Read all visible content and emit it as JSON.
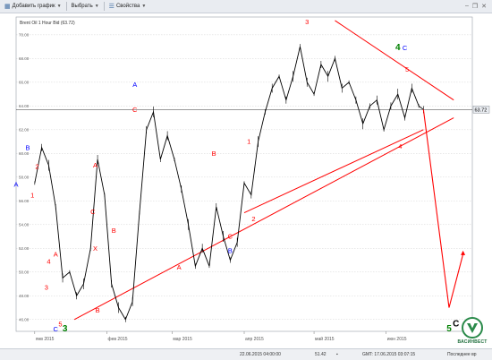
{
  "toolbar": {
    "items": [
      {
        "label": "Добавить график",
        "icon": "add-chart-icon"
      },
      {
        "label": "Выбрать",
        "icon": "select-icon"
      },
      {
        "label": "Свойства",
        "icon": "properties-icon"
      }
    ]
  },
  "chart_data": {
    "type": "line",
    "instrument_label": "Brent Oil 1 Hour Bid (63.72)",
    "last_price": "63.72",
    "colors": {
      "price": "#000000",
      "trendlines": "#ff0000",
      "labels_red": "#ff0000",
      "labels_blue": "#0000ff",
      "labels_green": "#008000",
      "grid": "#c8c8c8"
    },
    "grid": true,
    "y_ticks": [
      "70.00",
      "68.00",
      "66.00",
      "64.00",
      "62.00",
      "60.00",
      "58.00",
      "56.00",
      "54.00",
      "52.00",
      "50.00",
      "48.00",
      "46.00"
    ],
    "x_ticks": [
      "янв 2015",
      "фев 2015",
      "мар 2015",
      "апр 2015",
      "май 2015",
      "июн 2015"
    ],
    "series": [
      {
        "x": [
          "2015-01-01",
          "2015-01-04",
          "2015-01-07",
          "2015-01-10",
          "2015-01-13",
          "2015-01-16",
          "2015-01-19",
          "2015-01-22",
          "2015-01-25",
          "2015-01-28",
          "2015-01-31",
          "2015-02-03",
          "2015-02-06",
          "2015-02-09",
          "2015-02-12",
          "2015-02-15",
          "2015-02-18",
          "2015-02-21",
          "2015-02-24",
          "2015-02-27",
          "2015-03-02",
          "2015-03-05",
          "2015-03-08",
          "2015-03-11",
          "2015-03-14",
          "2015-03-17",
          "2015-03-20",
          "2015-03-23",
          "2015-03-26",
          "2015-03-29",
          "2015-04-01",
          "2015-04-04",
          "2015-04-07",
          "2015-04-10",
          "2015-04-13",
          "2015-04-16",
          "2015-04-19",
          "2015-04-22",
          "2015-04-25",
          "2015-04-28",
          "2015-05-01",
          "2015-05-04",
          "2015-05-07",
          "2015-05-10",
          "2015-05-13",
          "2015-05-16",
          "2015-05-19",
          "2015-05-22",
          "2015-05-25",
          "2015-05-28",
          "2015-05-31",
          "2015-06-03",
          "2015-06-06",
          "2015-06-09",
          "2015-06-12",
          "2015-06-15",
          "2015-06-17"
        ],
        "values": [
          57.5,
          60.5,
          59.0,
          55.5,
          49.5,
          50.0,
          48.0,
          49.0,
          52.0,
          59.5,
          56.5,
          49.0,
          47.0,
          46.0,
          47.5,
          55.0,
          62.0,
          63.5,
          59.5,
          61.5,
          59.5,
          57.0,
          54.0,
          50.5,
          52.0,
          50.5,
          55.5,
          53.0,
          51.0,
          52.5,
          57.5,
          56.5,
          61.0,
          63.5,
          65.5,
          66.5,
          64.5,
          66.5,
          69.0,
          66.0,
          65.0,
          67.5,
          66.5,
          68.0,
          65.5,
          66.0,
          64.5,
          62.5,
          64.0,
          64.5,
          62.0,
          64.0,
          65.0,
          63.0,
          65.5,
          64.0,
          63.7
        ]
      }
    ],
    "forecast": {
      "x": [
        "2015-06-17",
        "2015-06-28",
        "2015-07-04"
      ],
      "values": [
        63.7,
        47.0,
        51.5
      ]
    },
    "trendlines": [
      {
        "x": [
          "2015-01-18",
          "2015-06-30"
        ],
        "values": [
          46.0,
          63.0
        ]
      },
      {
        "x": [
          "2015-04-01",
          "2015-06-17"
        ],
        "values": [
          55.0,
          62.0
        ]
      },
      {
        "x": [
          "2015-05-10",
          "2015-06-30"
        ],
        "values": [
          71.2,
          64.5
        ]
      }
    ],
    "y_range": [
      45.0,
      71.5
    ],
    "x_range": [
      "2014-12-24",
      "2015-07-08"
    ],
    "wave_labels": [
      {
        "text": "A",
        "x": "2014-12-24",
        "value": 57.2,
        "color": "blue"
      },
      {
        "text": "B",
        "x": "2014-12-29",
        "value": 60.3,
        "color": "blue"
      },
      {
        "text": "2",
        "x": "2015-01-02",
        "value": 58.7,
        "color": "red"
      },
      {
        "text": "1",
        "x": "2014-12-31",
        "value": 56.3,
        "color": "red"
      },
      {
        "text": "4",
        "x": "2015-01-07",
        "value": 50.7,
        "color": "red"
      },
      {
        "text": "A",
        "x": "2015-01-10",
        "value": 51.3,
        "color": "red"
      },
      {
        "text": "3",
        "x": "2015-01-06",
        "value": 48.5,
        "color": "red"
      },
      {
        "text": "5",
        "x": "2015-01-12",
        "value": 45.4,
        "color": "red"
      },
      {
        "text": "C",
        "x": "2015-01-10",
        "value": 45.0,
        "color": "blue"
      },
      {
        "text": "3",
        "x": "2015-01-14",
        "value": 45.0,
        "color": "green"
      },
      {
        "text": "B",
        "x": "2015-01-28",
        "value": 46.6,
        "color": "red"
      },
      {
        "text": "X",
        "x": "2015-01-27",
        "value": 51.8,
        "color": "red"
      },
      {
        "text": "C",
        "x": "2015-01-26",
        "value": 54.9,
        "color": "red"
      },
      {
        "text": "A",
        "x": "2015-01-27",
        "value": 58.8,
        "color": "red"
      },
      {
        "text": "B",
        "x": "2015-02-04",
        "value": 53.3,
        "color": "red"
      },
      {
        "text": "C",
        "x": "2015-02-13",
        "value": 63.5,
        "color": "red"
      },
      {
        "text": "A",
        "x": "2015-02-13",
        "value": 65.6,
        "color": "blue"
      },
      {
        "text": "A",
        "x": "2015-03-04",
        "value": 50.2,
        "color": "red"
      },
      {
        "text": "B",
        "x": "2015-03-19",
        "value": 59.8,
        "color": "red"
      },
      {
        "text": "C",
        "x": "2015-03-26",
        "value": 52.8,
        "color": "red"
      },
      {
        "text": "B",
        "x": "2015-03-26",
        "value": 51.6,
        "color": "blue"
      },
      {
        "text": "1",
        "x": "2015-04-03",
        "value": 60.8,
        "color": "red"
      },
      {
        "text": "2",
        "x": "2015-04-05",
        "value": 54.3,
        "color": "red"
      },
      {
        "text": "3",
        "x": "2015-04-28",
        "value": 70.9,
        "color": "red"
      },
      {
        "text": "4",
        "x": "2015-06-07",
        "value": 60.4,
        "color": "red"
      },
      {
        "text": "5",
        "x": "2015-06-10",
        "value": 66.9,
        "color": "red"
      },
      {
        "text": "4",
        "x": "2015-06-06",
        "value": 68.7,
        "color": "green"
      },
      {
        "text": "C",
        "x": "2015-06-09",
        "value": 68.7,
        "color": "blue"
      },
      {
        "text": "5",
        "x": "2015-06-28",
        "value": 45.0,
        "color": "green"
      },
      {
        "text": "C",
        "x": "2015-07-01",
        "value": 45.4,
        "color": "black"
      }
    ]
  },
  "status_bar": {
    "date_cursor": "22.06.2015 04:00:00",
    "cursor_value": "51.42",
    "server_time": "GMT: 17.06.2015 03:07:15",
    "last_update": "Последнее вр"
  },
  "logo": {
    "name": "ВАСИНВЕСТ"
  }
}
